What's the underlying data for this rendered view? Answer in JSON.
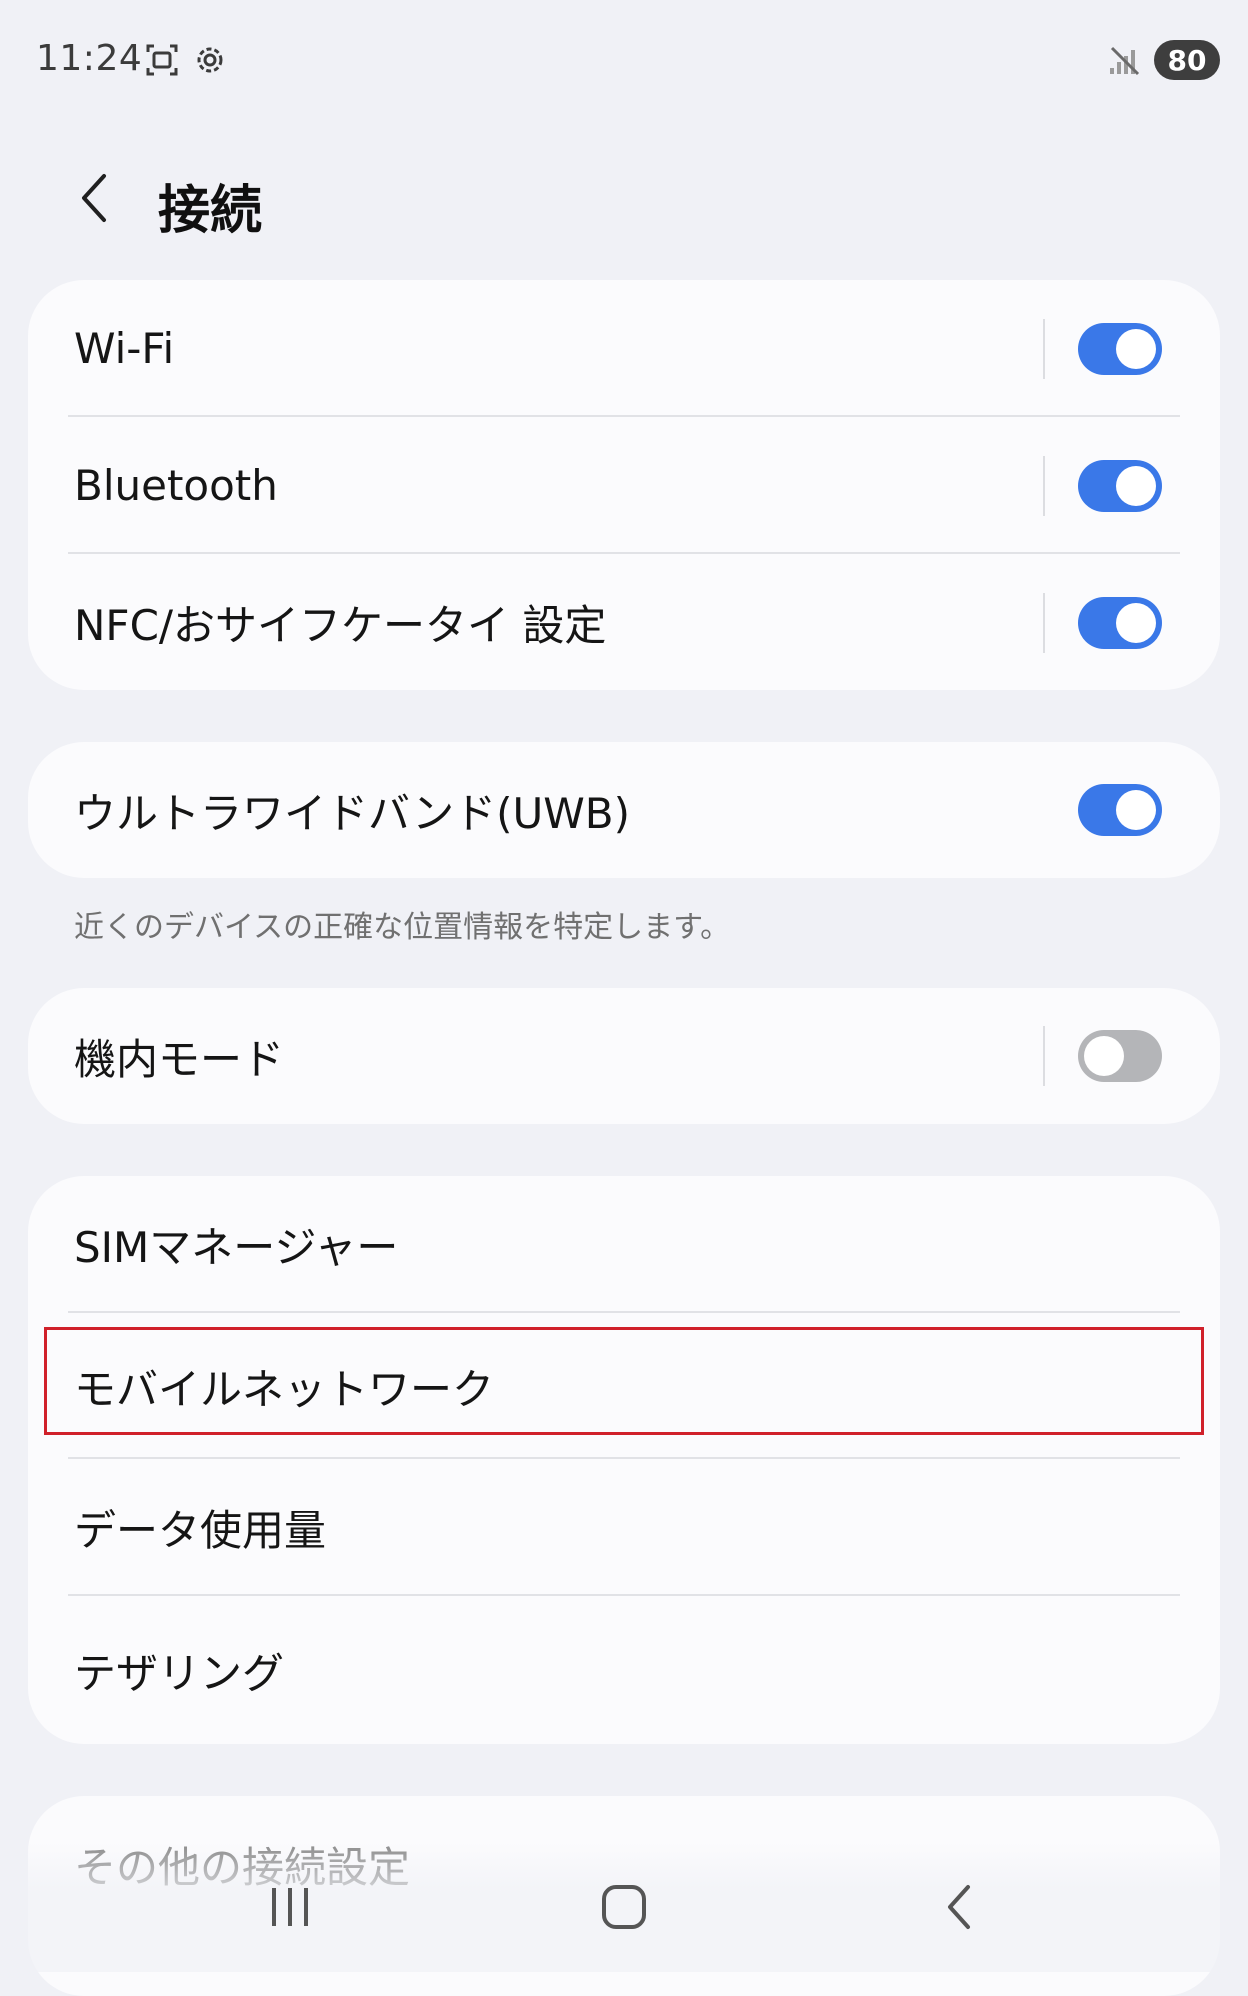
{
  "status_bar": {
    "time": "11:24",
    "battery": "80",
    "icons": [
      "screenshot-icon",
      "settings-gear-icon",
      "no-signal-icon"
    ]
  },
  "header": {
    "back_icon": "chevron-left-icon",
    "title": "接続"
  },
  "groups": [
    {
      "rows": [
        {
          "label": "Wi-Fi",
          "toggle": true
        },
        {
          "label": "Bluetooth",
          "toggle": true
        },
        {
          "label": "NFC/おサイフケータイ 設定",
          "toggle": true
        }
      ]
    },
    {
      "rows": [
        {
          "label": "ウルトラワイドバンド(UWB)",
          "toggle": true
        }
      ],
      "helper": "近くのデバイスの正確な位置情報を特定します。"
    },
    {
      "rows": [
        {
          "label": "機内モード",
          "toggle": false
        }
      ]
    },
    {
      "rows": [
        {
          "label": "SIMマネージャー"
        },
        {
          "label": "モバイルネットワーク"
        },
        {
          "label": "データ使用量"
        },
        {
          "label": "テザリング"
        }
      ]
    },
    {
      "rows": [
        {
          "label": "その他の接続設定"
        }
      ]
    }
  ],
  "colors": {
    "accent": "#3a78e8",
    "toggle_off": "#b4b5b8",
    "highlight": "#d0202a",
    "background": "#f0f1f6",
    "card": "#fbfbfd"
  },
  "nav": [
    "recent-apps-icon",
    "home-icon",
    "back-icon"
  ]
}
